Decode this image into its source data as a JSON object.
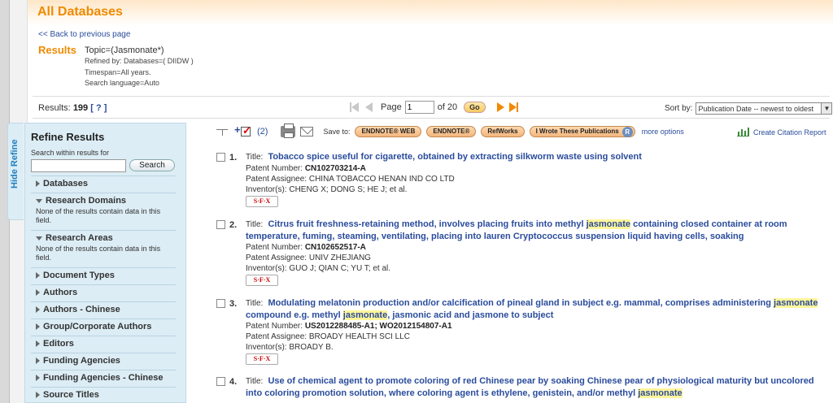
{
  "header": {
    "title": "All Databases"
  },
  "back_link": "<< Back to previous page",
  "query": {
    "results_label": "Results",
    "topic": "Topic=(Jasmonate*)",
    "refined_by": "Refined by: Databases=( DIIDW )",
    "timespan": "Timespan=All years.",
    "language": "Search language=Auto"
  },
  "results_bar": {
    "label": "Results:",
    "count": "199",
    "help": "[ ? ]",
    "page_label": "Page",
    "page_value": "1",
    "of_pages": "of 20",
    "go": "Go",
    "sort_label": "Sort by:",
    "sort_value": "Publication Date -- newest to oldest"
  },
  "refine": {
    "hide_tab": "Hide Refine",
    "title": "Refine Results",
    "search_label": "Search within results for",
    "search_button": "Search",
    "facets": [
      {
        "label": "Databases",
        "expanded": false,
        "note": ""
      },
      {
        "label": "Research Domains",
        "expanded": true,
        "note": "None of the results contain data in this field."
      },
      {
        "label": "Research Areas",
        "expanded": true,
        "note": "None of the results contain data in this field."
      },
      {
        "label": "Document Types",
        "expanded": false,
        "note": ""
      },
      {
        "label": "Authors",
        "expanded": false,
        "note": ""
      },
      {
        "label": "Authors - Chinese",
        "expanded": false,
        "note": ""
      },
      {
        "label": "Group/Corporate Authors",
        "expanded": false,
        "note": ""
      },
      {
        "label": "Editors",
        "expanded": false,
        "note": ""
      },
      {
        "label": "Funding Agencies",
        "expanded": false,
        "note": ""
      },
      {
        "label": "Funding Agencies - Chinese",
        "expanded": false,
        "note": ""
      },
      {
        "label": "Source Titles",
        "expanded": false,
        "note": ""
      }
    ]
  },
  "toolbar": {
    "marked_count": "(2)",
    "save_to": "Save to:",
    "endnote_web": "ENDNOTE® WEB",
    "endnote": "ENDNOTE®",
    "refworks": "RefWorks",
    "wrote_these": "I Wrote These Publications",
    "r_badge": "R",
    "more_options": "more options",
    "create_citation_report": "Create Citation Report"
  },
  "records": [
    {
      "num": "1.",
      "title_label": "Title:",
      "title_parts": [
        "Tobacco spice useful for cigarette, obtained by extracting silkworm waste using solvent"
      ],
      "patent_number_label": "Patent Number:",
      "patent_number": "CN102703214-A",
      "assignee_label": "Patent Assignee:",
      "assignee": "CHINA TOBACCO HENAN IND CO LTD",
      "inventors_label": "Inventor(s):",
      "inventors": "CHENG X; DONG S; HE J; et al."
    },
    {
      "num": "2.",
      "title_label": "Title:",
      "title_parts": [
        "Citrus fruit freshness-retaining method, involves placing fruits into methyl ",
        "jasmonate",
        " containing closed container at room temperature, fuming, steaming, ventilating, placing into lauren Cryptococcus suspension liquid having cells, soaking"
      ],
      "patent_number_label": "Patent Number:",
      "patent_number": "CN102652517-A",
      "assignee_label": "Patent Assignee:",
      "assignee": "UNIV ZHEJIANG",
      "inventors_label": "Inventor(s):",
      "inventors": "GUO J; QIAN C; YU T; et al."
    },
    {
      "num": "3.",
      "title_label": "Title:",
      "title_parts": [
        "Modulating melatonin production and/or calcification of pineal gland in subject e.g. mammal, comprises administering ",
        "jasmonate",
        " compound e.g. methyl ",
        "jasmonate",
        ", jasmonic acid and jasmone to subject"
      ],
      "patent_number_label": "Patent Number:",
      "patent_number": "US2012288485-A1; WO2012154807-A1",
      "assignee_label": "Patent Assignee:",
      "assignee": "BROADY HEALTH SCI LLC",
      "inventors_label": "Inventor(s):",
      "inventors": "BROADY B."
    },
    {
      "num": "4.",
      "title_label": "Title:",
      "title_parts": [
        "Use of chemical agent to promote coloring of red Chinese pear by soaking Chinese pear of physiological maturity but uncolored into coloring promotion solution, where coloring agent is ethylene, genistein, and/or methyl ",
        "jasmonate"
      ]
    }
  ],
  "sfx_label": "S·F·X",
  "colors": {
    "brand_orange": "#f08a00",
    "link_blue": "#2a4c9c",
    "refine_bg": "#dcedf5",
    "highlight": "#fff59a"
  }
}
